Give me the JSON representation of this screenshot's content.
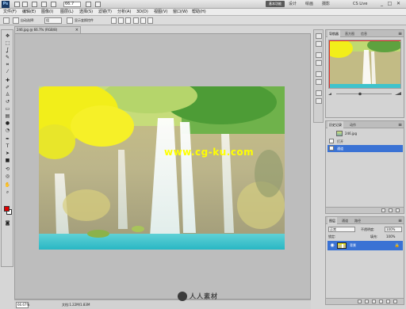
{
  "appbar": {
    "logo": "Ps",
    "zoom": "66.7",
    "workspace_label": "基本功能",
    "workspace_items": [
      "设计",
      "绘画",
      "摄影"
    ],
    "cs_live": "CS Live",
    "window_controls": [
      "_",
      "□",
      "✕"
    ]
  },
  "menu": [
    "文件(F)",
    "编辑(E)",
    "图像(I)",
    "图层(L)",
    "选择(S)",
    "滤镜(T)",
    "分析(A)",
    "3D(D)",
    "视图(V)",
    "窗口(W)",
    "帮助(H)"
  ],
  "options": {
    "auto_select": "自动选择:",
    "auto_select_value": "组",
    "show_transform": "显示变换控件"
  },
  "document": {
    "tab_title": "246.jpg @ 66.7% (RGB/8)",
    "close": "×",
    "watermark": "www.cg-ku.com"
  },
  "status": {
    "zoom": "66.67%",
    "doc_info": "文档:1.22M/1.83M"
  },
  "navigator_panel": {
    "tabs": [
      "导航器",
      "直方图",
      "信息"
    ],
    "menu": "≡"
  },
  "history_panel": {
    "tabs": [
      "历史记录",
      "动作"
    ],
    "doc_name": "246.jpg",
    "items": [
      "打开",
      "通道"
    ],
    "menu": "≡"
  },
  "layers_panel": {
    "tabs": [
      "图层",
      "通道",
      "路径"
    ],
    "blend_mode": "正常",
    "opacity_label": "不透明度:",
    "opacity_value": "100%",
    "lock_label": "锁定:",
    "fill_label": "填充:",
    "fill_value": "100%",
    "layer_name": "背景",
    "menu": "≡"
  },
  "site_logo": "人人素材",
  "colors": {
    "foreground": "#e00000",
    "background": "#ffffff",
    "selection": "#3a72d4",
    "workspace_button": "#5a5a5a"
  }
}
